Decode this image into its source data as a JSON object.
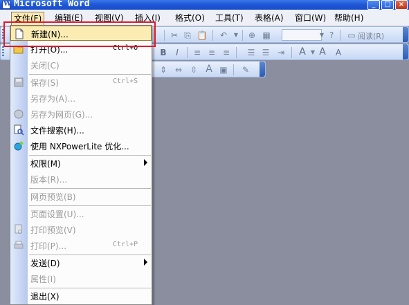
{
  "window": {
    "title": "Microsoft Word",
    "min_glyph": "_",
    "max_glyph": "□",
    "close_glyph": "×"
  },
  "menubar": {
    "items": [
      {
        "label": "文件(F)",
        "active": true
      },
      {
        "label": "编辑(E)"
      },
      {
        "label": "视图(V)"
      },
      {
        "label": "插入(I)"
      },
      {
        "label": "格式(O)"
      },
      {
        "label": "工具(T)"
      },
      {
        "label": "表格(A)"
      },
      {
        "label": "窗口(W)"
      },
      {
        "label": "帮助(H)"
      }
    ]
  },
  "toolbar": {
    "reading_mode_label": "阅读(R)",
    "bold_label": "B",
    "italic_label": "I"
  },
  "file_menu": {
    "items": [
      {
        "label": "新建(N)...",
        "shortcut": "",
        "icon": "new-document-icon",
        "state": "highlighted"
      },
      {
        "label": "打开(O)...",
        "shortcut": "Ctrl+O",
        "icon": "open-folder-icon"
      },
      {
        "label": "关闭(C)",
        "shortcut": "",
        "state": "disabled"
      },
      {
        "label": "保存(S)",
        "shortcut": "Ctrl+S",
        "icon": "save-icon",
        "state": "disabled"
      },
      {
        "label": "另存为(A)...",
        "shortcut": "",
        "state": "disabled"
      },
      {
        "label": "另存为网页(G)...",
        "shortcut": "",
        "icon": "save-as-web-icon",
        "state": "disabled"
      },
      {
        "label": "文件搜索(H)...",
        "shortcut": "",
        "icon": "file-search-icon"
      },
      {
        "label": "使用 NXPowerLite 优化...",
        "shortcut": "",
        "icon": "nxpowerlite-icon"
      },
      {
        "label": "权限(M)",
        "shortcut": "",
        "submenu": true
      },
      {
        "label": "版本(R)...",
        "shortcut": "",
        "state": "disabled"
      },
      {
        "label": "网页预览(B)",
        "shortcut": "",
        "state": "disabled"
      },
      {
        "label": "页面设置(U)...",
        "shortcut": "",
        "state": "disabled"
      },
      {
        "label": "打印预览(V)",
        "shortcut": "",
        "icon": "print-preview-icon",
        "state": "disabled"
      },
      {
        "label": "打印(P)...",
        "shortcut": "Ctrl+P",
        "icon": "print-icon",
        "state": "disabled"
      },
      {
        "label": "发送(D)",
        "shortcut": "",
        "submenu": true
      },
      {
        "label": "属性(I)",
        "shortcut": "",
        "state": "disabled"
      },
      {
        "label": "退出(X)",
        "shortcut": ""
      }
    ]
  }
}
